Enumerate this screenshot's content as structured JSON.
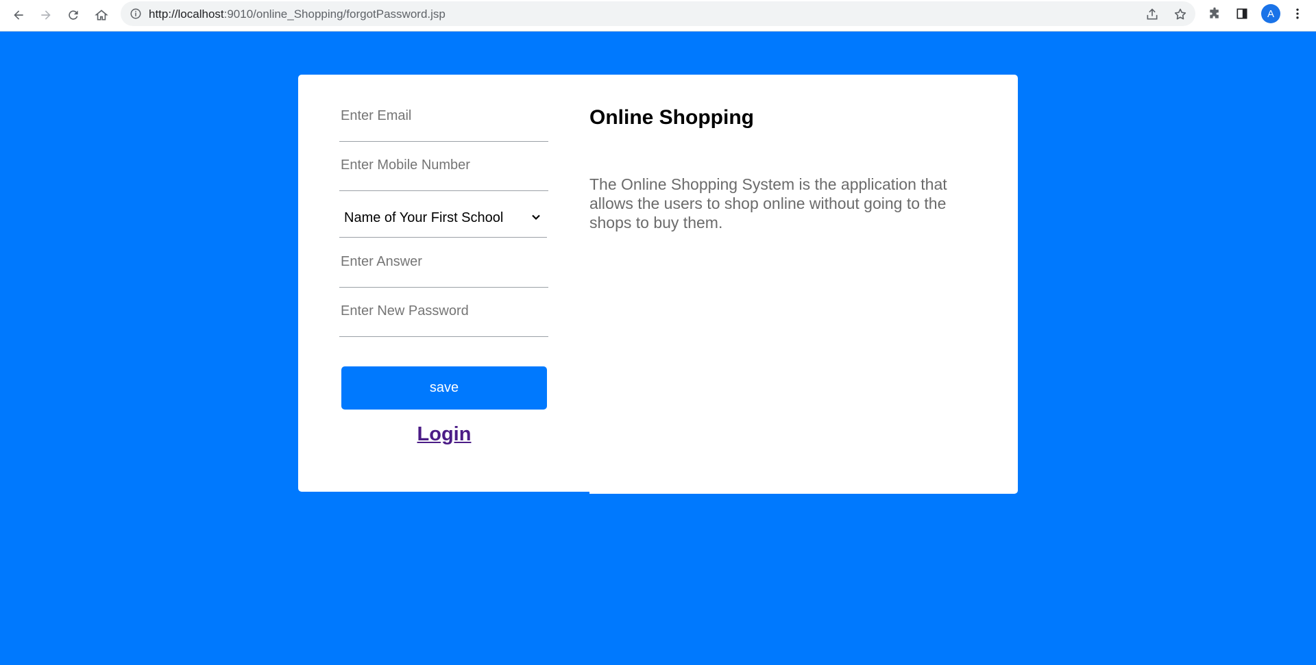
{
  "browser": {
    "url_host": "http://localhost",
    "url_rest": ":9010/online_Shopping/forgotPassword.jsp",
    "avatar_letter": "A"
  },
  "form": {
    "email_placeholder": "Enter Email",
    "mobile_placeholder": "Enter Mobile Number",
    "security_question": "Name of Your First School",
    "answer_placeholder": "Enter Answer",
    "password_placeholder": "Enter New Password",
    "save_label": "save",
    "login_label": "Login"
  },
  "info": {
    "title": "Online Shopping",
    "description": "The Online Shopping System is the application that allows the users to shop online without going to the shops to buy them."
  },
  "colors": {
    "background": "#0079fe",
    "button": "#0079fe",
    "link": "#4b1c86"
  }
}
